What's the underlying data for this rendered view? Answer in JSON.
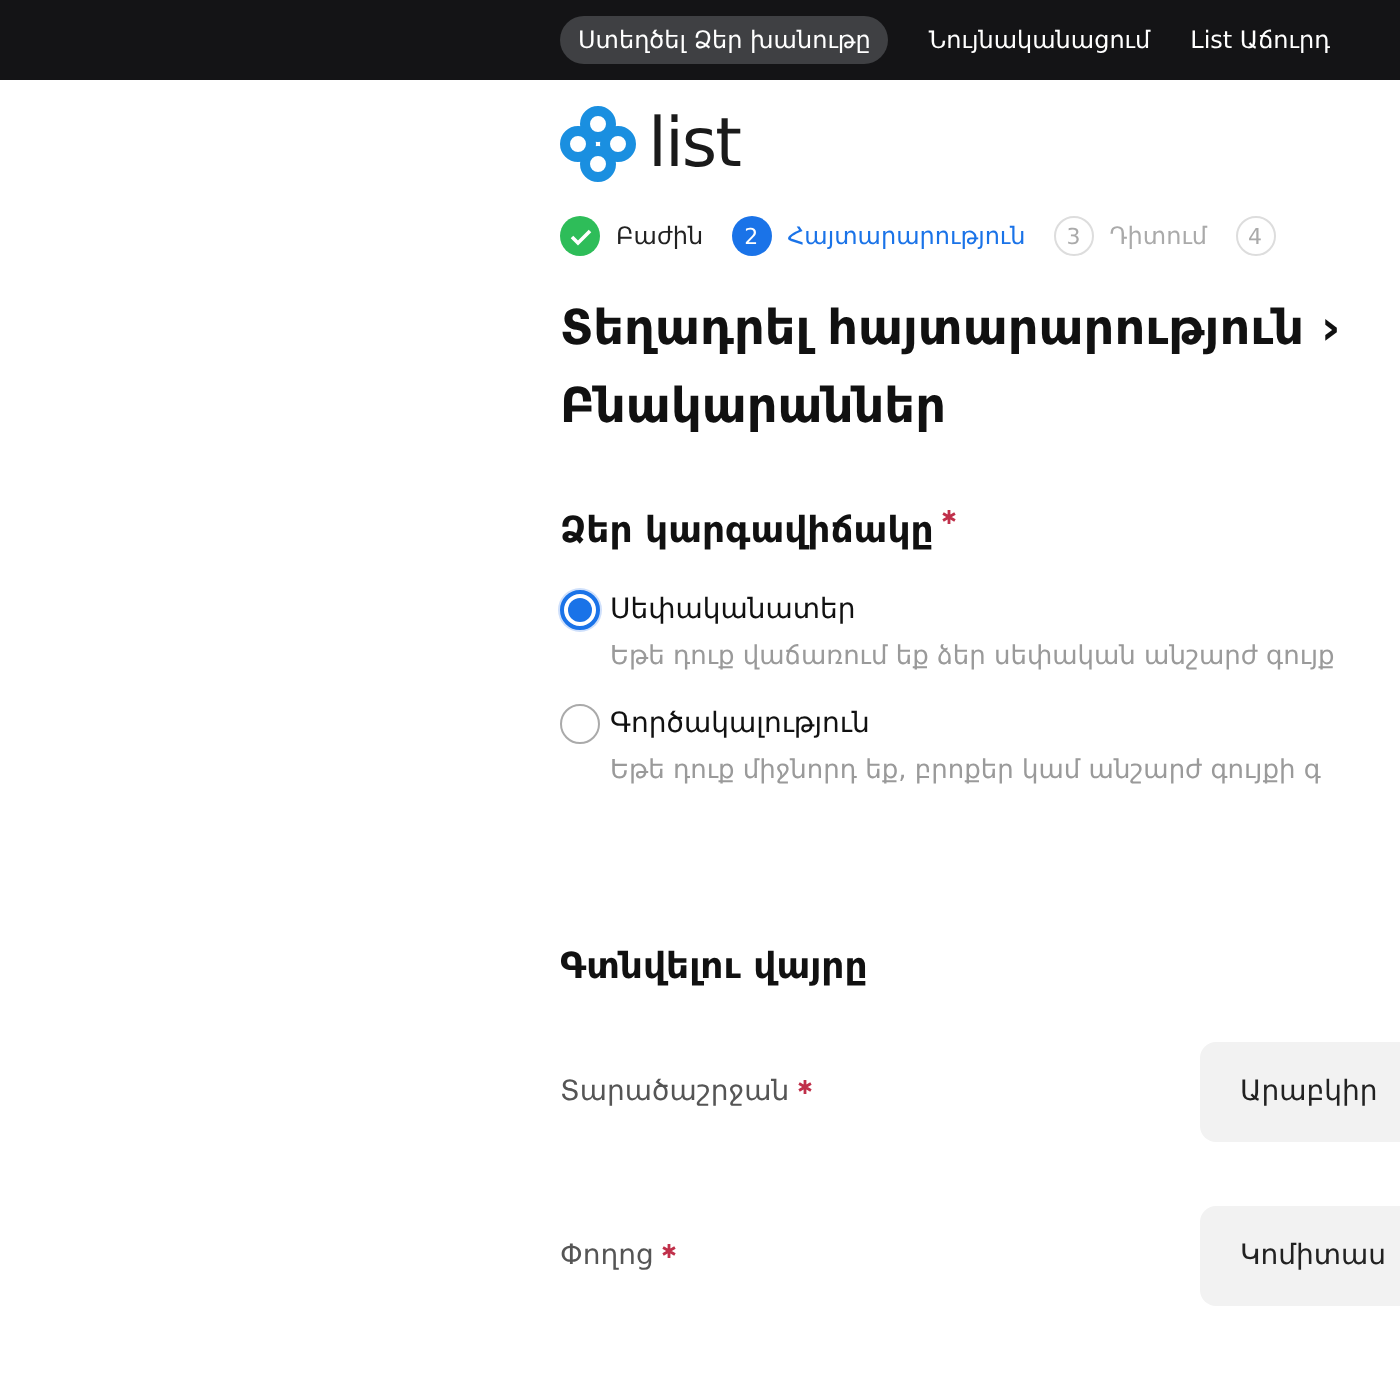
{
  "top_nav": {
    "items": [
      {
        "label": "Ստեղծել Ձեր խանութը",
        "kind": "pill"
      },
      {
        "label": "Նույնականացում",
        "kind": "link"
      },
      {
        "label": "List Աճուրդ",
        "kind": "link"
      }
    ]
  },
  "logo": {
    "text": "list"
  },
  "steps": [
    {
      "label": "Բաժին",
      "completed": true,
      "selected": false
    },
    {
      "number": "2",
      "label": "Հայտարարություն",
      "completed": false,
      "selected": true
    },
    {
      "number": "3",
      "label": "Դիտում",
      "completed": false,
      "selected": false
    },
    {
      "number": "4",
      "completed": false,
      "selected": false
    }
  ],
  "title": "Տեղադրել հայտարարություն › Բնակարաններ",
  "status_section": {
    "heading": "Ձեր կարգավիճակը",
    "required": true,
    "options": [
      {
        "label": "Սեփականատեր",
        "description": "Եթե դուք վաճառում եք ձեր սեփական անշարժ գույք",
        "selected": true
      },
      {
        "label": "Գործակալություն",
        "description": "Եթե դուք միջնորդ եք, բրոքեր կամ անշարժ գույքի գ",
        "selected": false
      }
    ]
  },
  "location_section": {
    "heading": "Գտնվելու վայրը",
    "fields": [
      {
        "label": "Տարածաշրջան",
        "required": true,
        "value": "Արաբկիր"
      },
      {
        "label": "Փողոց",
        "required": true,
        "value": "Կոմիտաս"
      }
    ]
  }
}
